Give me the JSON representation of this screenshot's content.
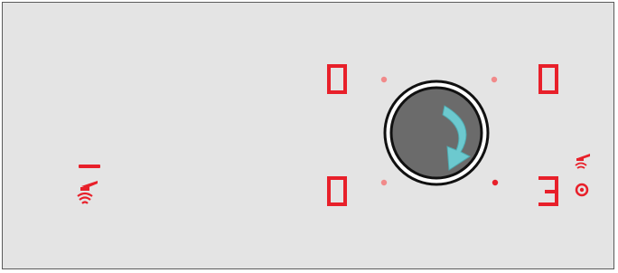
{
  "cooktop": {
    "accent_color": "#e8202a",
    "inactive_dot_color": "#f18a8a",
    "zones": [
      {
        "id": "front-left",
        "level": "0",
        "active": false
      },
      {
        "id": "back-left",
        "level": "0",
        "active": false
      },
      {
        "id": "back-right",
        "level": "0",
        "active": false
      },
      {
        "id": "front-right",
        "level": "3",
        "active": true
      }
    ],
    "selector_knob": {
      "icon": "clockwise-rotate-arrow",
      "arrow_color": "#6cc9cf"
    },
    "side_indicator": {
      "display": "1",
      "icon": "pan-heat-icon"
    },
    "front_right_status_icons": [
      "pan-heat-icon",
      "active-zone-ring-icon"
    ]
  }
}
